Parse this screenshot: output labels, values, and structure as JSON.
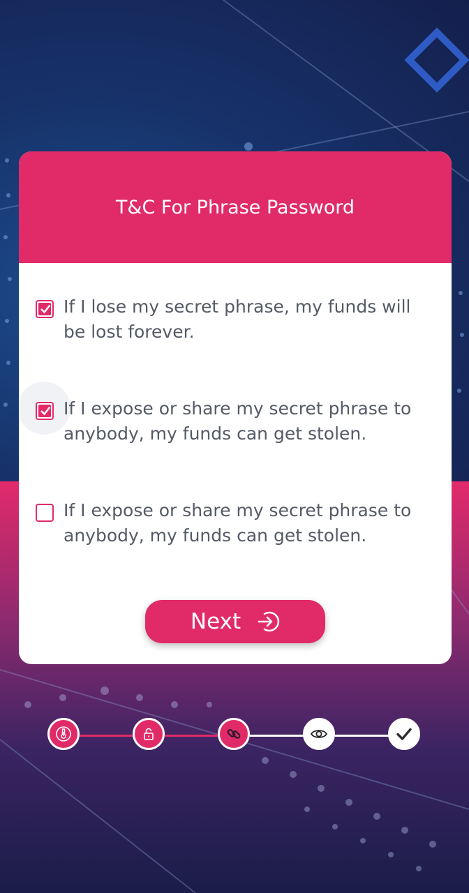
{
  "title": "T&C For Phrase Password",
  "terms": [
    {
      "text": "If I lose my secret phrase, my funds will be lost forever.",
      "checked": true
    },
    {
      "text": "If I expose or share my secret phrase to anybody, my funds can get stolen.",
      "checked": true
    },
    {
      "text": "If I expose or share my secret phrase to anybody, my funds can get stolen.",
      "checked": false
    }
  ],
  "next_button": {
    "label": "Next",
    "icon": "arrow-right-circle-icon"
  },
  "stepper": {
    "steps": [
      {
        "icon": "thermometer-icon",
        "status": "done"
      },
      {
        "icon": "unlock-icon",
        "status": "done"
      },
      {
        "icon": "link-icon",
        "status": "current"
      },
      {
        "icon": "eye-icon",
        "status": "pending"
      },
      {
        "icon": "check-icon",
        "status": "pending"
      }
    ]
  },
  "colors": {
    "accent": "#e12b68",
    "card": "#ffffff",
    "text": "#555a66"
  }
}
